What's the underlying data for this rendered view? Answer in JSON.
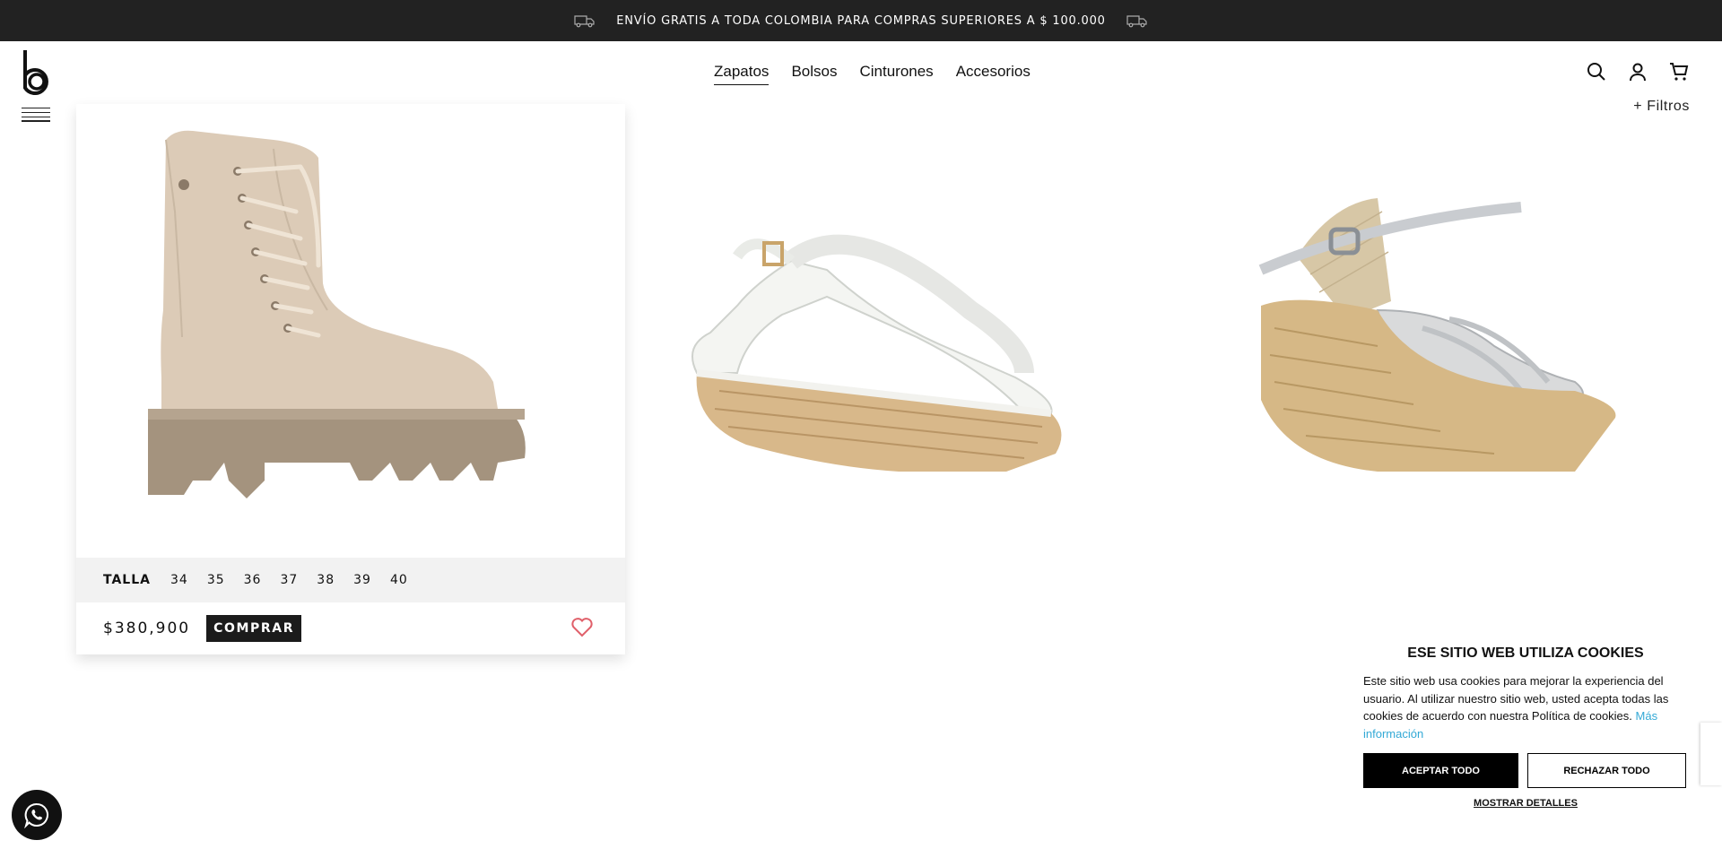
{
  "announcement": {
    "text": "ENVÍO GRATIS A TODA COLOMBIA PARA COMPRAS SUPERIORES A $ 100.000",
    "left_icon": "truck-icon",
    "right_icon": "truck-icon"
  },
  "header": {
    "logo": "b",
    "nav": [
      "Zapatos",
      "Bolsos",
      "Cinturones",
      "Accesorios"
    ],
    "active_nav": "Zapatos",
    "icons": [
      "search-icon",
      "user-icon",
      "cart-icon"
    ],
    "menu_icon": "hamburger-icon"
  },
  "filters": {
    "label": "+ Filtros"
  },
  "products": [
    {
      "name": "beige lace-up boot",
      "sizes_label": "TALLA",
      "sizes": [
        "34",
        "35",
        "36",
        "37",
        "38",
        "39",
        "40"
      ],
      "price": "$380,900",
      "buy_label": "COMPRAR"
    },
    {
      "name": "white espadrille slingback wedge"
    },
    {
      "name": "silver espadrille wedge sandal"
    }
  ],
  "cookie_banner": {
    "title": "ESE SITIO WEB UTILIZA COOKIES",
    "body": "Este sitio web usa cookies para mejorar la experiencia del usuario. Al utilizar nuestro sitio web, usted acepta todas las cookies de acuerdo con nuestra Política de cookies.",
    "more_link": "Más información",
    "accept_label": "ACEPTAR TODO",
    "reject_label": "RECHAZAR TODO",
    "details_label": "MOSTRAR DETALLES"
  },
  "colors": {
    "topbar": "#222222",
    "accent_link": "#33a9d6",
    "heart": "#e0606a"
  },
  "whatsapp_icon": "whatsapp-icon"
}
